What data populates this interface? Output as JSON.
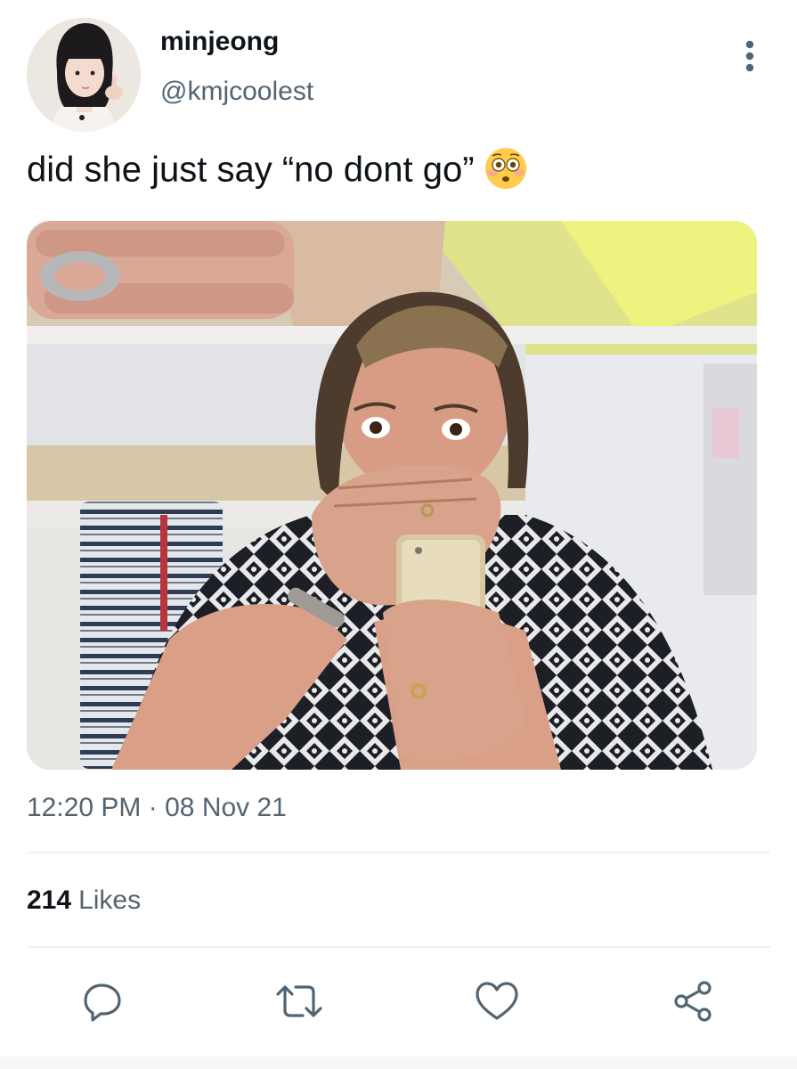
{
  "tweet": {
    "author": {
      "display_name": "minjeong",
      "handle": "@kmjcoolest"
    },
    "text": "did she just say “no dont go”",
    "emoji": "flushed-face",
    "time": "12:20 PM",
    "separator": "·",
    "date": "08 Nov 21",
    "likes_count": "214",
    "likes_label": "Likes"
  },
  "actions": [
    "reply-icon",
    "retweet-icon",
    "like-icon",
    "share-icon"
  ],
  "colors": {
    "text_primary": "#0f1419",
    "text_secondary": "#536471",
    "divider": "#eff3f4",
    "icon": "#536471"
  }
}
